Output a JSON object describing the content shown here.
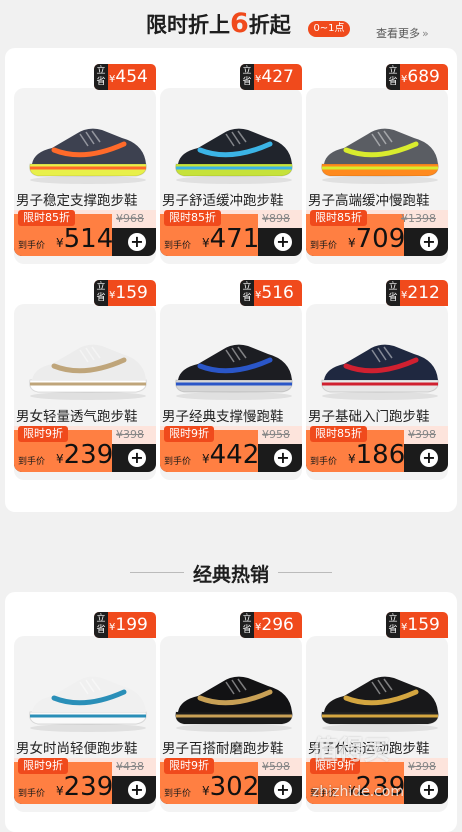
{
  "section1": {
    "title_prefix": "限时折上",
    "title_big": "6",
    "title_mid": "折",
    "title_suffix": "起",
    "range_pill": "0~1点",
    "see_more": "查看更多",
    "see_more_arrows": "»"
  },
  "section2": {
    "title": "经典热销"
  },
  "common": {
    "save_label": "立省",
    "currency": "¥",
    "hand_label": "到手价",
    "add": "+"
  },
  "products": [
    {
      "save": "454",
      "name": "男子稳定支撑跑步鞋",
      "limit": "限时85折",
      "orig": "¥968",
      "price": "514",
      "upper": "#3d4150",
      "sole": "#e8f04a",
      "accent": "#ff6a2a"
    },
    {
      "save": "427",
      "name": "男子舒适缓冲跑步鞋",
      "limit": "限时85折",
      "orig": "¥898",
      "price": "471",
      "upper": "#20242c",
      "sole": "#c6e23a",
      "accent": "#3bb4e6"
    },
    {
      "save": "689",
      "name": "男子高端缓冲慢跑鞋",
      "limit": "限时85折",
      "orig": "¥1398",
      "price": "709",
      "upper": "#5a5d63",
      "sole": "#ff8a1e",
      "accent": "#d9ec2e"
    },
    {
      "save": "159",
      "name": "男女轻量透气跑步鞋",
      "limit": "限时9折",
      "orig": "¥398",
      "price": "239",
      "upper": "#ececec",
      "sole": "#ffffff",
      "accent": "#bfa57a"
    },
    {
      "save": "516",
      "name": "男子经典支撑慢跑鞋",
      "limit": "限时9折",
      "orig": "¥958",
      "price": "442",
      "upper": "#1c1d22",
      "sole": "#d6d6d6",
      "accent": "#2a56c8"
    },
    {
      "save": "212",
      "name": "男子基础入门跑步鞋",
      "limit": "限时85折",
      "orig": "¥398",
      "price": "186",
      "upper": "#1f2840",
      "sole": "#e8e8e8",
      "accent": "#d02030"
    },
    {
      "save": "199",
      "name": "男女时尚轻便跑步鞋",
      "limit": "限时9折",
      "orig": "¥438",
      "price": "239",
      "upper": "#f0f0f0",
      "sole": "#fafafa",
      "accent": "#2a8fb8"
    },
    {
      "save": "296",
      "name": "男子百搭耐磨跑步鞋",
      "limit": "限时9折",
      "orig": "¥598",
      "price": "302",
      "upper": "#121214",
      "sole": "#1a1a1a",
      "accent": "#c8a055"
    },
    {
      "save": "159",
      "name": "男子休闲运动跑步鞋",
      "limit": "限时9折",
      "orig": "¥398",
      "price": "239",
      "upper": "#18181a",
      "sole": "#222222",
      "accent": "#d4a640"
    }
  ],
  "watermark": {
    "text": "值得买",
    "url": "zhizhide.com"
  }
}
